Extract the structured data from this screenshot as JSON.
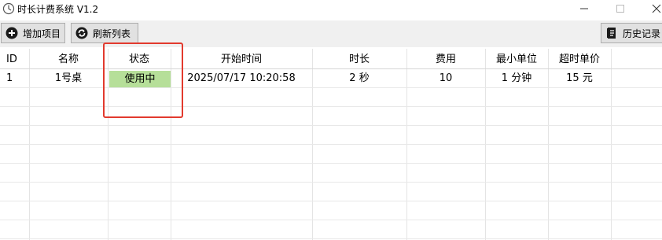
{
  "window": {
    "title": "时长计费系统 V1.2",
    "controls": [
      "minimize",
      "maximize",
      "close"
    ]
  },
  "toolbar": {
    "add_label": "增加项目",
    "add_icon": "plus-circle-icon",
    "refresh_label": "刷新列表",
    "refresh_icon": "refresh-icon",
    "history_label": "历史记录",
    "history_icon": "history-book-icon"
  },
  "table": {
    "columns": [
      "ID",
      "名称",
      "状态",
      "开始时间",
      "时长",
      "费用",
      "最小单位",
      "超时单价"
    ],
    "rows": [
      [
        "1",
        "1号桌",
        "使用中",
        "2025/07/17 10:20:58",
        "2 秒",
        "10",
        "1 分钟",
        "15 元"
      ]
    ]
  },
  "colors": {
    "status_in_use": "#b6df99",
    "highlight_border": "#e23a2e"
  }
}
